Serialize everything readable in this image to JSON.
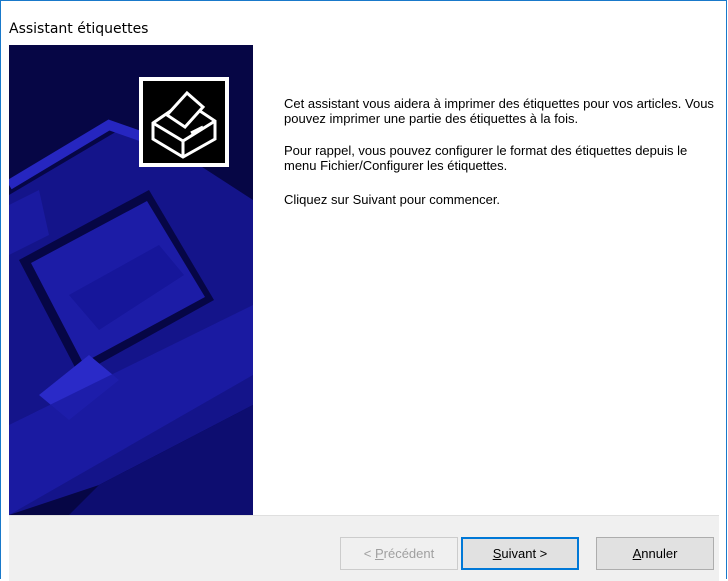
{
  "window": {
    "title": "Assistant étiquettes"
  },
  "banner": {
    "icon": "printer-icon",
    "colors": {
      "dark": "#060645",
      "mid": "#1a1a9a",
      "light": "#2323b8"
    }
  },
  "body": {
    "paragraphs": [
      "Cet assistant vous aidera à imprimer des étiquettes pour vos articles. Vous pouvez imprimer une partie des étiquettes à la fois.",
      "Pour rappel, vous pouvez configurer le format des étiquettes depuis le menu Fichier/Configurer les étiquettes.",
      "Cliquez sur Suivant pour commencer."
    ]
  },
  "buttons": {
    "previous": {
      "prefix": "< ",
      "mnemonic": "P",
      "rest": "récédent",
      "enabled": false
    },
    "next": {
      "prefix": "",
      "mnemonic": "S",
      "rest": "uivant >",
      "enabled": true,
      "default": true
    },
    "cancel": {
      "prefix": "",
      "mnemonic": "A",
      "rest": "nnuler",
      "enabled": true
    }
  }
}
